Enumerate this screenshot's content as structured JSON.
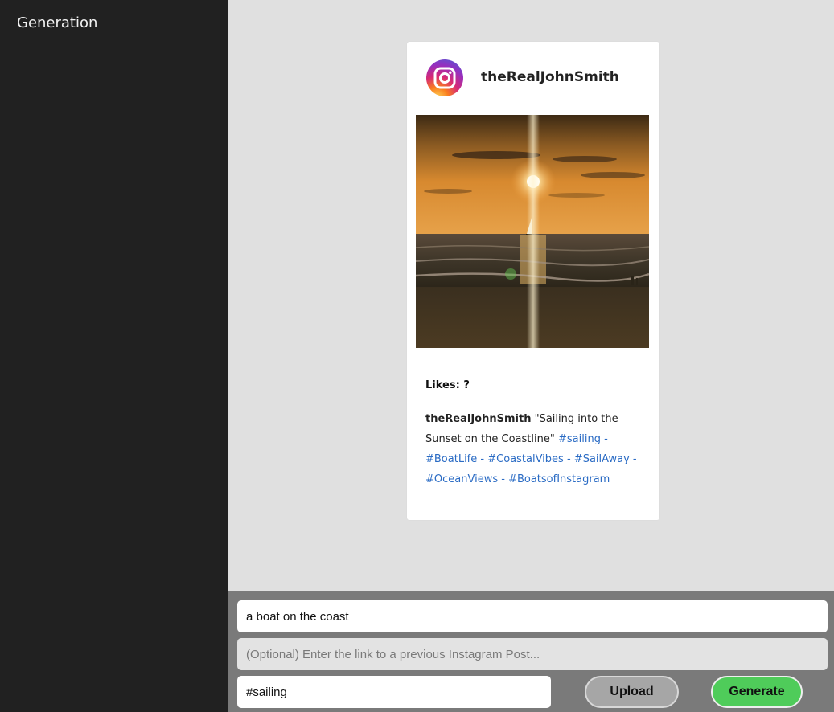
{
  "sidebar": {
    "title": "Generation"
  },
  "post": {
    "username": "theRealJohnSmith",
    "avatar_icon": "instagram-icon",
    "likes_label": "Likes: ?",
    "caption_user": "theRealJohnSmith",
    "caption_text": "\"Sailing into the Sunset on the Coastline\"",
    "hashtags": [
      "#sailing",
      "#BoatLife",
      "#CoastalVibes",
      "#SailAway",
      "#OceanViews",
      "#BoatsofInstagram"
    ],
    "hashtag_separator": " - ",
    "image_description_icon": "sunset-sailboat-photo"
  },
  "form": {
    "prompt_value": "a boat on the coast",
    "link_placeholder": "(Optional) Enter the link to a previous Instagram Post...",
    "hashtag_value": "#sailing",
    "upload_label": "Upload",
    "generate_label": "Generate"
  },
  "colors": {
    "sidebar_bg": "#212121",
    "main_bg": "#e0e0e0",
    "bottom_bar_bg": "#7a7a7a",
    "hashtag_link": "#2a6bc4",
    "generate_button": "#4fcc5a",
    "upload_button": "#a6a6a6"
  }
}
